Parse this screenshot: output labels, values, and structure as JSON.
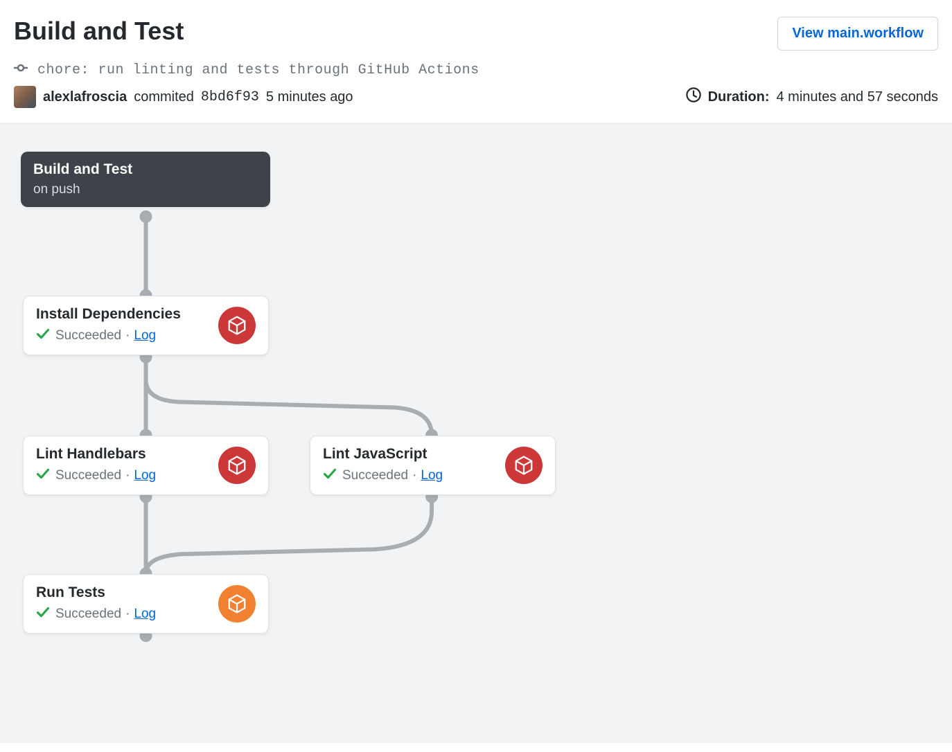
{
  "header": {
    "title": "Build and Test",
    "view_button": "View main.workflow"
  },
  "commit": {
    "message": "chore: run linting and tests through GitHub Actions",
    "author": "alexlafroscia",
    "action_word": "commited",
    "sha": "8bd6f93",
    "relative_time": "5 minutes ago"
  },
  "duration": {
    "label": "Duration:",
    "value": "4 minutes and 57 seconds"
  },
  "workflow": {
    "entry": {
      "title": "Build and Test",
      "trigger": "on push"
    },
    "nodes": [
      {
        "id": "install",
        "title": "Install Dependencies",
        "status": "Succeeded",
        "log_label": "Log",
        "icon_color": "red"
      },
      {
        "id": "lint_handlebars",
        "title": "Lint Handlebars",
        "status": "Succeeded",
        "log_label": "Log",
        "icon_color": "red"
      },
      {
        "id": "lint_javascript",
        "title": "Lint JavaScript",
        "status": "Succeeded",
        "log_label": "Log",
        "icon_color": "red"
      },
      {
        "id": "run_tests",
        "title": "Run Tests",
        "status": "Succeeded",
        "log_label": "Log",
        "icon_color": "orange"
      }
    ],
    "edges": [
      [
        "entry",
        "install"
      ],
      [
        "install",
        "lint_handlebars"
      ],
      [
        "install",
        "lint_javascript"
      ],
      [
        "lint_handlebars",
        "run_tests"
      ],
      [
        "lint_javascript",
        "run_tests"
      ]
    ]
  }
}
